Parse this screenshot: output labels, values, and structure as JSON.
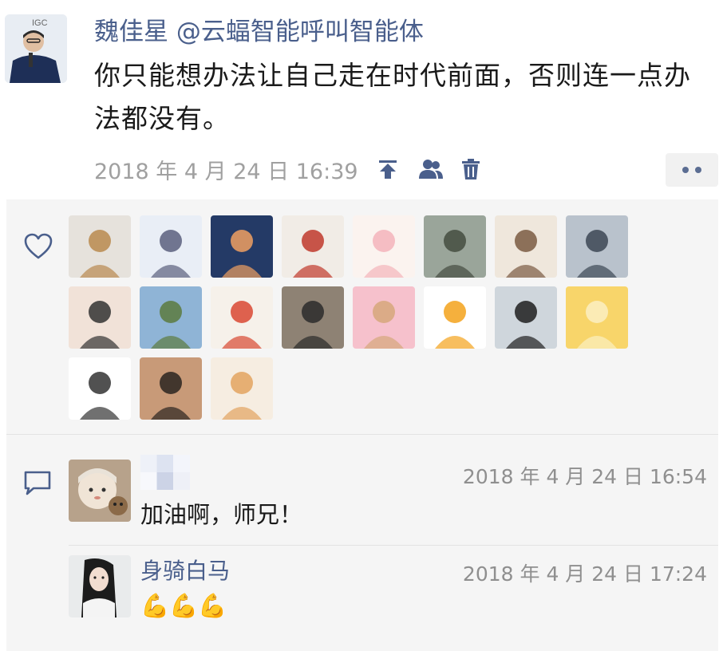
{
  "post": {
    "author": "魏佳星 @云蝠智能呼叫智能体",
    "text": "你只能想办法让自己走在时代前面，否则连一点办法都没有。",
    "timestamp": "2018 年 4 月 24 日 16:39",
    "icons": [
      "pin-top-icon",
      "contacts-icon",
      "trash-icon",
      "more-icon"
    ]
  },
  "likes": {
    "icon": "heart-icon",
    "avatars": [
      {
        "name": "cat",
        "colors": [
          "#e6e2dc",
          "#b8894e"
        ]
      },
      {
        "name": "anime-boy",
        "colors": [
          "#e9eef6",
          "#5a5f7e"
        ]
      },
      {
        "name": "sunset-silhouette",
        "colors": [
          "#243a66",
          "#f0a061"
        ]
      },
      {
        "name": "red-bear",
        "colors": [
          "#f1ece6",
          "#c0392b"
        ]
      },
      {
        "name": "pig-drink",
        "colors": [
          "#fbf3ef",
          "#f3b3bb"
        ]
      },
      {
        "name": "family-outdoor",
        "colors": [
          "#9aa59a",
          "#444c40"
        ]
      },
      {
        "name": "cartoon-girl",
        "colors": [
          "#efe7dc",
          "#7a5a42"
        ]
      },
      {
        "name": "launch-tower",
        "colors": [
          "#b9c2cc",
          "#3c4754"
        ]
      },
      {
        "name": "couple-cartoon",
        "colors": [
          "#f1e2d8",
          "#333"
        ]
      },
      {
        "name": "beach-rocks",
        "colors": [
          "#8fb4d6",
          "#5c7a3e"
        ]
      },
      {
        "name": "balloon",
        "colors": [
          "#f6f1ea",
          "#d94832"
        ]
      },
      {
        "name": "man-suit",
        "colors": [
          "#8e8274",
          "#2b2b2b"
        ]
      },
      {
        "name": "pink-cat",
        "colors": [
          "#f6c1cc",
          "#d6a77a"
        ]
      },
      {
        "name": "sun-face",
        "colors": [
          "#ffffff",
          "#f3a21b"
        ]
      },
      {
        "name": "man-coast",
        "colors": [
          "#cfd6dc",
          "#1f1f1f"
        ]
      },
      {
        "name": "deer",
        "colors": [
          "#f8d56a",
          "#fbefc2"
        ]
      },
      {
        "name": "sketch-man",
        "colors": [
          "#ffffff",
          "#333333"
        ]
      },
      {
        "name": "man-portrait",
        "colors": [
          "#c89a78",
          "#2a2420"
        ]
      },
      {
        "name": "mother-child",
        "colors": [
          "#f6ede1",
          "#e3a35f"
        ]
      }
    ]
  },
  "comments_icon": "comment-icon",
  "comments": [
    {
      "name": "",
      "time": "2018 年 4 月 24 日 16:54",
      "text": "加油啊，师兄！",
      "avatar": "baby-photo"
    },
    {
      "name": "身骑白马",
      "time": "2018 年 4 月 24 日 17:24",
      "text": "💪💪💪",
      "avatar": "woman-photo"
    }
  ],
  "colors": {
    "name_blue": "#4a5f8c",
    "time_gray": "#a0a0a0",
    "panel_bg": "#f5f5f5"
  }
}
